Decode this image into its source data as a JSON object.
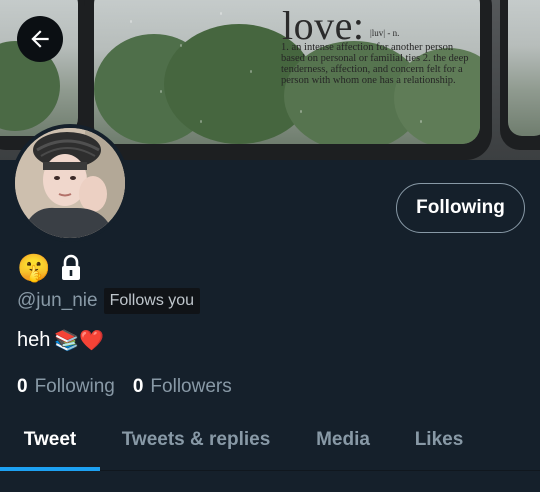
{
  "header": {
    "banner": {
      "title_word": "love:",
      "pronunciation": "|luv| - n.",
      "definition": "1. an intense affection for another person based on personal or familial ties 2. the deep tenderness, affection, and concern felt for a person with whom one has a relationship."
    },
    "back_icon": "arrow-left-icon"
  },
  "profile": {
    "display_emoji": "🤫",
    "locked_icon": "lock-icon",
    "handle": "@jun_nie",
    "follows_you": "Follows you",
    "bio_text": "heh",
    "bio_emojis": "📚❤️",
    "follow_button_label": "Following",
    "stats": {
      "following_count": "0",
      "following_label": "Following",
      "followers_count": "0",
      "followers_label": "Followers"
    }
  },
  "tabs": [
    {
      "label": "Tweet",
      "active": true
    },
    {
      "label": "Tweets & replies",
      "active": false
    },
    {
      "label": "Media",
      "active": false
    },
    {
      "label": "Likes",
      "active": false
    }
  ],
  "colors": {
    "background": "#15202b",
    "accent": "#1da1f2",
    "secondary_text": "#8899a6"
  }
}
